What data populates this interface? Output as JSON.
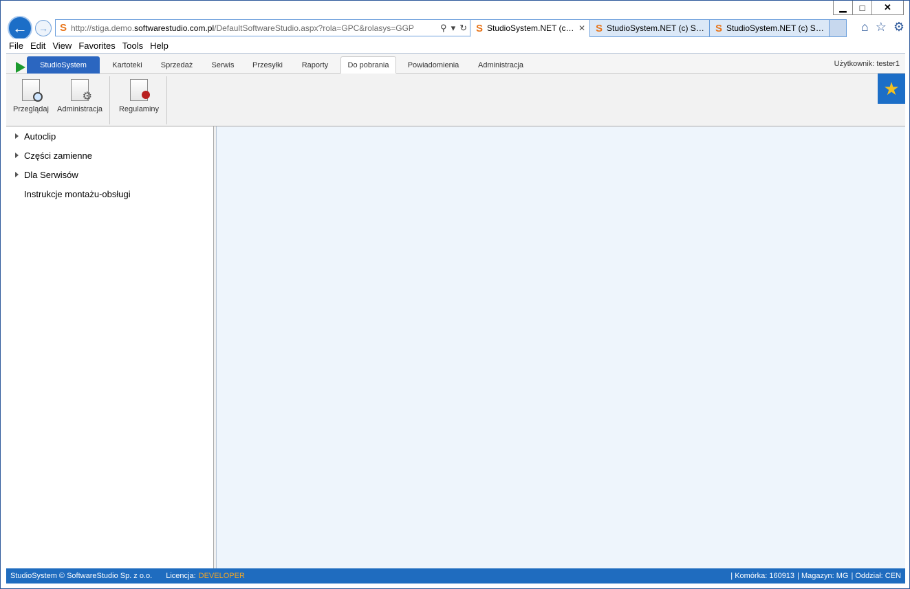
{
  "browser": {
    "url_prefix": "http://stiga.demo.",
    "url_domain": "softwarestudio.com.pl",
    "url_path": "/DefaultSoftwareStudio.aspx?rola=GPC&rolasys=GGP",
    "tabs": [
      {
        "title": "StudioSystem.NET (c) ...",
        "close": "✕"
      },
      {
        "title": "StudioSystem.NET (c) Sof..."
      },
      {
        "title": "StudioSystem.NET (c) Sof..."
      }
    ],
    "window_controls": {
      "minimize": "▁",
      "maximize": "□",
      "close": "✕"
    }
  },
  "menu": [
    "File",
    "Edit",
    "View",
    "Favorites",
    "Tools",
    "Help"
  ],
  "app_tabs": [
    {
      "label": "StudioSystem"
    },
    {
      "label": "Kartoteki"
    },
    {
      "label": "Sprzedaż"
    },
    {
      "label": "Serwis"
    },
    {
      "label": "Przesyłki"
    },
    {
      "label": "Raporty"
    },
    {
      "label": "Do pobrania"
    },
    {
      "label": "Powiadomienia"
    },
    {
      "label": "Administracja"
    }
  ],
  "user_label": "Użytkownik: tester1",
  "ribbon": {
    "buttons": [
      {
        "label": "Przeglądaj",
        "icon": "document-search-icon"
      },
      {
        "label": "Administracja",
        "icon": "document-settings-icon"
      },
      {
        "label": "Regulaminy",
        "icon": "document-seal-icon"
      }
    ]
  },
  "tree": [
    {
      "label": "Autoclip",
      "expandable": true
    },
    {
      "label": "Części zamienne",
      "expandable": true
    },
    {
      "label": "Dla Serwisów",
      "expandable": true
    },
    {
      "label": "Instrukcje montażu-obsługi",
      "expandable": false
    }
  ],
  "status": {
    "copyright": "StudioSystem © SoftwareStudio Sp. z o.o.",
    "license_label": "Licencja:",
    "license_value": "DEVELOPER",
    "cell": "| Komórka: 160913",
    "warehouse": "| Magazyn: MG",
    "branch": "| Oddział: CEN"
  },
  "colors": {
    "accent": "#1f6cbf",
    "license": "#f5a623",
    "content_bg": "#eef5fc"
  }
}
